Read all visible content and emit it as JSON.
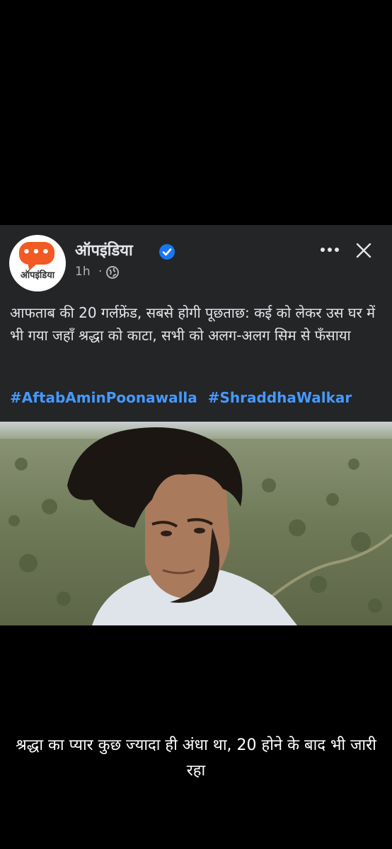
{
  "post": {
    "avatar_text": "ऑपइंडिया",
    "avatar_icon": "speech-bubble-logo",
    "page_name": "ऑपइंडिया",
    "verified_icon": "verified-badge-icon",
    "time": "1h",
    "separator": "·",
    "audience_icon": "globe-icon",
    "headline": "आफताब की 20 गर्लफ्रेंड, सबसे होगी पूछताछ: कई को लेकर उस घर में भी गया जहाँ श्रद्धा को काटा, सभी को अलग-अलग सिम से फँसाया",
    "hashtags": [
      "#AftabAminPoonawalla",
      "#ShraddhaWalkar"
    ],
    "more_icon": "more-options-icon",
    "close_icon": "close-icon"
  },
  "caption": "श्रद्धा का प्यार कुछ ज्यादा ही अंधा था, 20 होने के बाद भी जारी रहा",
  "colors": {
    "accent": "#4599ff",
    "card_bg": "#242526",
    "logo": "#f15a24",
    "verified": "#1877f2"
  }
}
